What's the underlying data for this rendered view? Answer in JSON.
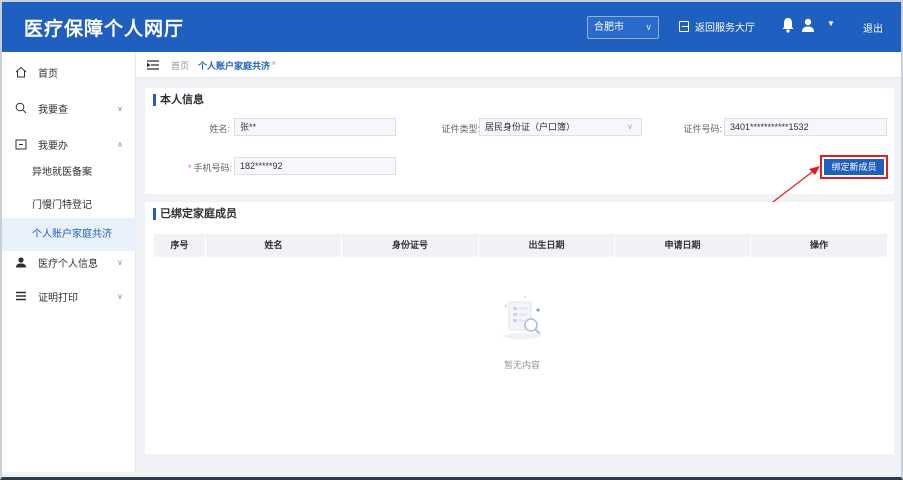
{
  "header": {
    "title": "医疗保障个人网厅",
    "city": "合肥市",
    "back_link": "返回服务大厅",
    "logout": "退出",
    "accent": "#1f5fbf"
  },
  "sidebar": {
    "items": [
      {
        "label": "首页",
        "icon": "home-icon"
      },
      {
        "label": "我要查",
        "icon": "search-icon"
      },
      {
        "label": "我要办",
        "icon": "folder-icon"
      },
      {
        "label": "医疗个人信息",
        "icon": "user-icon"
      },
      {
        "label": "证明打印",
        "icon": "menu-icon"
      }
    ],
    "subitems": [
      {
        "label": "异地就医备案"
      },
      {
        "label": "门慢门特登记"
      },
      {
        "label": "个人账户家庭共济",
        "active": true
      }
    ]
  },
  "tabs": {
    "home": "首页",
    "active": "个人账户家庭共济",
    "close": "×"
  },
  "personal": {
    "title": "本人信息",
    "name_label": "姓名:",
    "name_value": "张**",
    "idtype_label": "证件类型:",
    "idtype_value": "居民身份证（户口簿）",
    "idno_label": "证件号码:",
    "idno_value": "3401***********1532",
    "phone_label": "手机号码:",
    "phone_value": "182*****92",
    "required_mark": "*",
    "bind_button": "绑定新成员"
  },
  "family": {
    "title": "已绑定家庭成员",
    "columns": [
      "序号",
      "姓名",
      "身份证号",
      "出生日期",
      "申请日期",
      "操作"
    ],
    "rows": [],
    "empty_text": "暂无内容"
  }
}
